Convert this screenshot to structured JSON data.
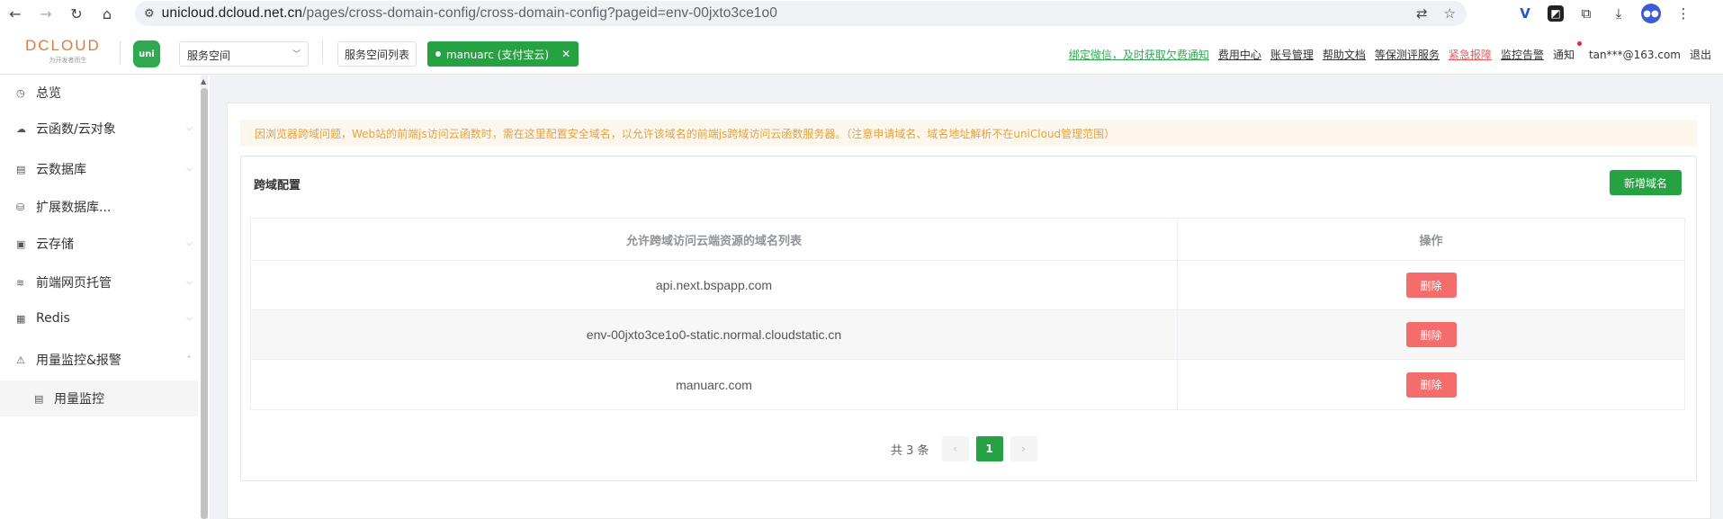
{
  "browser": {
    "back_icon": "←",
    "forward_icon": "→",
    "reload_icon": "↻",
    "home_icon": "⌂",
    "secure_icon": "⚙",
    "url_domain": "unicloud.dcloud.net.cn",
    "url_path": "/pages/cross-domain-config/cross-domain-config?pageid=env-00jxto3ce1o0"
  },
  "header": {
    "logo_text": "DCLOUD",
    "logo_sub": "为开发者而生",
    "uni_badge": "uni",
    "space_select_value": "服务空间",
    "space_list_label": "服务空间列表",
    "space_tag_label": "manuarc (支付宝云)",
    "links": [
      {
        "label": "绑定微信，及时获取欠费通知",
        "style": "green"
      },
      {
        "label": "费用中心",
        "style": "plain"
      },
      {
        "label": "账号管理",
        "style": "plain"
      },
      {
        "label": "帮助文档",
        "style": "plain"
      },
      {
        "label": "等保测评服务",
        "style": "plain"
      },
      {
        "label": "紧急报障",
        "style": "red"
      },
      {
        "label": "监控告警",
        "style": "plain"
      }
    ],
    "notify_label": "通知",
    "user": "tan***@163.com",
    "logout": "退出"
  },
  "sidebar": {
    "items": [
      {
        "label": "总览",
        "icon": "◷",
        "arrow": ""
      },
      {
        "label": "云函数/云对象",
        "icon": "☁",
        "arrow": "⌵"
      },
      {
        "label": "云数据库",
        "icon": "▤",
        "arrow": "⌵"
      },
      {
        "label": "扩展数据库...",
        "icon": "⛁",
        "arrow": "⌵"
      },
      {
        "label": "云存储",
        "icon": "▣",
        "arrow": "⌵"
      },
      {
        "label": "前端网页托管",
        "icon": "≋",
        "arrow": "⌵"
      },
      {
        "label": "Redis",
        "icon": "▦",
        "arrow": "⌵"
      },
      {
        "label": "用量监控&报警",
        "icon": "⚠",
        "arrow": "⌃"
      },
      {
        "label": "用量监控",
        "icon": "▤",
        "arrow": ""
      }
    ]
  },
  "main": {
    "alert": "因浏览器跨域问题，Web站的前端js访问云函数时，需在这里配置安全域名，以允许该域名的前端js跨域访问云函数服务器。（注意申请域名、域名地址解析不在uniCloud管理范围）",
    "panel_title": "跨域配置",
    "add_button": "新增域名",
    "table": {
      "col_domain": "允许跨域访问云端资源的域名列表",
      "col_op": "操作",
      "rows": [
        {
          "domain": "api.next.bspapp.com",
          "action": "删除"
        },
        {
          "domain": "env-00jxto3ce1o0-static.normal.cloudstatic.cn",
          "action": "删除"
        },
        {
          "domain": "manuarc.com",
          "action": "删除"
        }
      ]
    },
    "pager": {
      "total": "共 3 条",
      "prev": "‹",
      "page": "1",
      "next": "›"
    }
  },
  "colors": {
    "brand_green": "#27a243",
    "danger_red": "#f56c6c",
    "alert_orange": "#e6a23c"
  }
}
